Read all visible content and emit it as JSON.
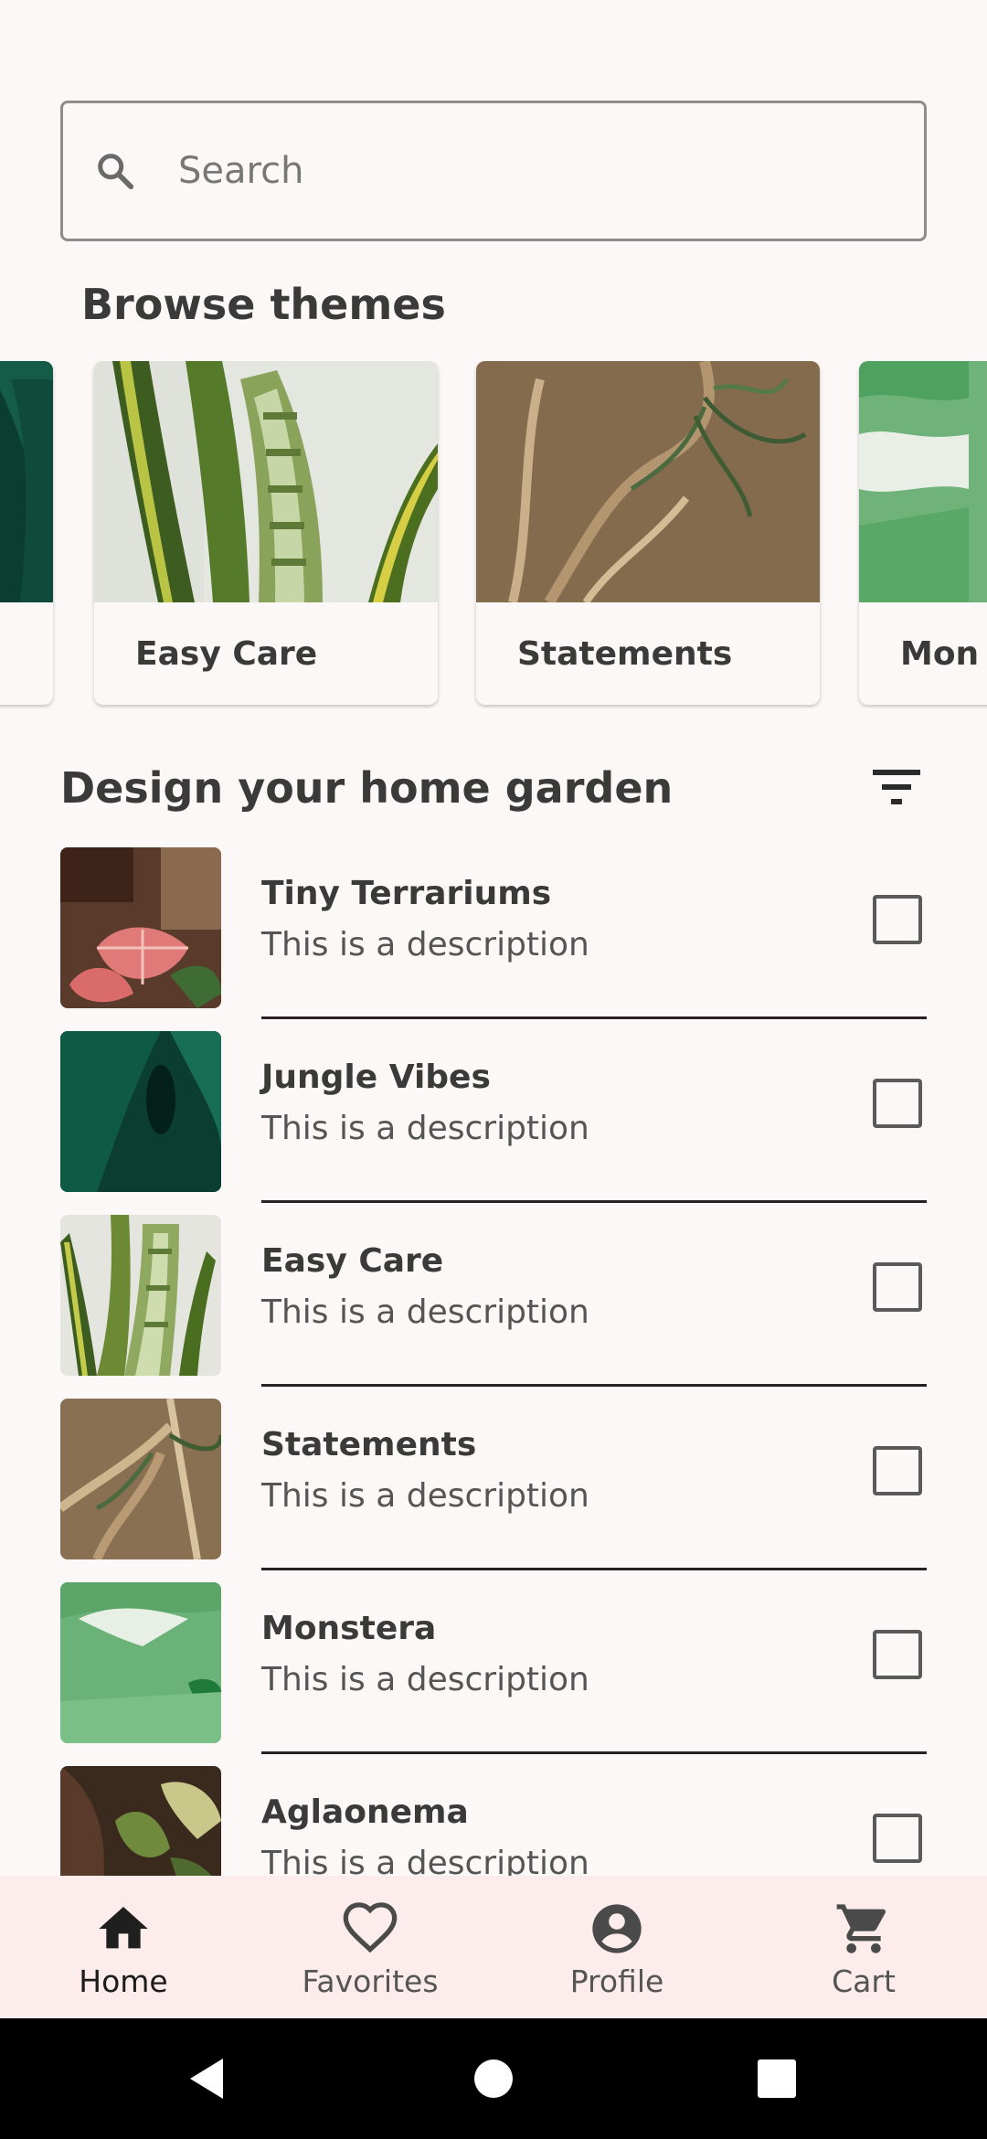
{
  "search": {
    "placeholder": "Search"
  },
  "browse": {
    "title": "Browse themes",
    "themes": [
      {
        "label": ""
      },
      {
        "label": "Easy Care"
      },
      {
        "label": "Statements"
      },
      {
        "label": "Mon"
      }
    ]
  },
  "design": {
    "title": "Design your home garden",
    "items": [
      {
        "title": "Tiny Terrariums",
        "description": "This is a description"
      },
      {
        "title": "Jungle Vibes",
        "description": "This is a description"
      },
      {
        "title": "Easy Care",
        "description": "This is a description"
      },
      {
        "title": "Statements",
        "description": "This is a description"
      },
      {
        "title": "Monstera",
        "description": "This is a description"
      },
      {
        "title": "Aglaonema",
        "description": "This is a description"
      }
    ]
  },
  "nav": {
    "items": [
      {
        "label": "Home",
        "icon": "home-icon"
      },
      {
        "label": "Favorites",
        "icon": "heart-outline-icon"
      },
      {
        "label": "Profile",
        "icon": "account-circle-icon"
      },
      {
        "label": "Cart",
        "icon": "cart-icon"
      }
    ]
  },
  "system_nav": {
    "icons": [
      "back-icon",
      "home-circle-icon",
      "recents-icon"
    ]
  },
  "colors": {
    "background": "#fdf8f8",
    "bottom_nav": "#fdecec",
    "divider": "#2a2026"
  }
}
